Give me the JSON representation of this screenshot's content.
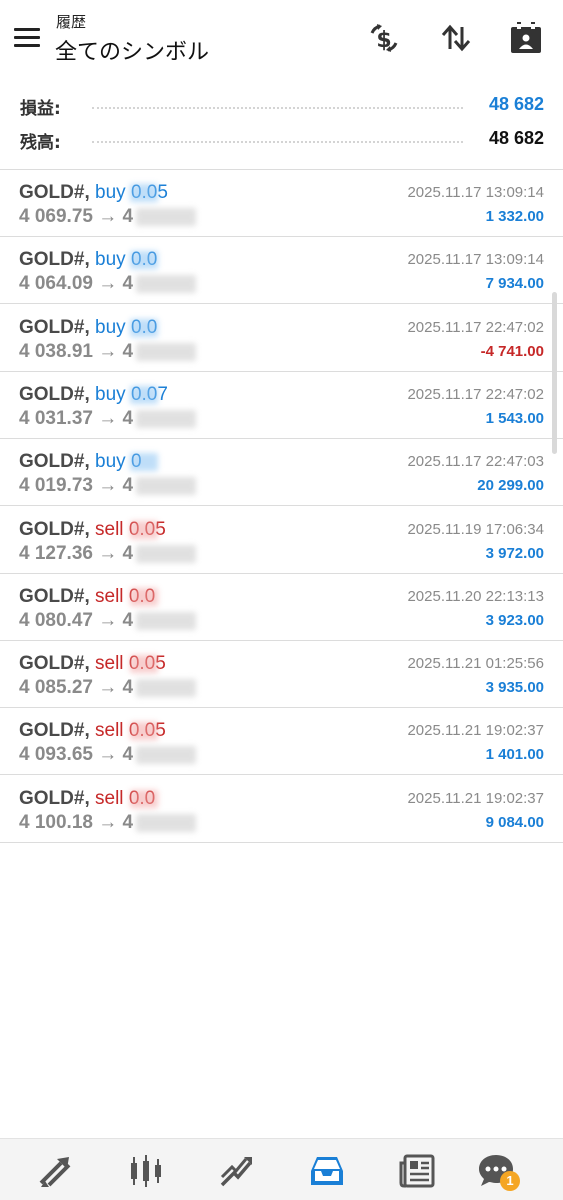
{
  "header": {
    "subtitle": "履歴",
    "title": "全てのシンボル",
    "icons": [
      "currency-exchange-icon",
      "sort-icon",
      "calendar-icon"
    ]
  },
  "summary": {
    "profit_label": "損益:",
    "profit_value": "48 682",
    "balance_label": "残高:",
    "balance_value": "48 682",
    "colors": {
      "profit": "#1a7fd6",
      "balance": "#111111"
    }
  },
  "trades": [
    {
      "symbol": "GOLD#,",
      "side": "buy",
      "volume": "0.05",
      "open_price": "4 069.75",
      "arrow": "→",
      "close_prefix": "4",
      "time": "2025.11.17 13:09:14",
      "profit": "1 332.00",
      "profit_sign": "pos"
    },
    {
      "symbol": "GOLD#,",
      "side": "buy",
      "volume": "0.0",
      "open_price": "4 064.09",
      "arrow": "→",
      "close_prefix": "4",
      "time": "2025.11.17 13:09:14",
      "profit": "7 934.00",
      "profit_sign": "pos"
    },
    {
      "symbol": "GOLD#,",
      "side": "buy",
      "volume": "0.0",
      "open_price": "4 038.91",
      "arrow": "→",
      "close_prefix": "4",
      "time": "2025.11.17 22:47:02",
      "profit": "-4 741.00",
      "profit_sign": "neg"
    },
    {
      "symbol": "GOLD#,",
      "side": "buy",
      "volume": "0.07",
      "open_price": "4 031.37",
      "arrow": "→",
      "close_prefix": "4",
      "time": "2025.11.17 22:47:02",
      "profit": "1 543.00",
      "profit_sign": "pos"
    },
    {
      "symbol": "GOLD#,",
      "side": "buy",
      "volume": "0",
      "open_price": "4 019.73",
      "arrow": "→",
      "close_prefix": "4",
      "time": "2025.11.17 22:47:03",
      "profit": "20 299.00",
      "profit_sign": "pos"
    },
    {
      "symbol": "GOLD#,",
      "side": "sell",
      "volume": "0.05",
      "open_price": "4 127.36",
      "arrow": "→",
      "close_prefix": "4",
      "time": "2025.11.19 17:06:34",
      "profit": "3 972.00",
      "profit_sign": "pos"
    },
    {
      "symbol": "GOLD#,",
      "side": "sell",
      "volume": "0.0",
      "open_price": "4 080.47",
      "arrow": "→",
      "close_prefix": "4",
      "time": "2025.11.20 22:13:13",
      "profit": "3 923.00",
      "profit_sign": "pos"
    },
    {
      "symbol": "GOLD#,",
      "side": "sell",
      "volume": "0.05",
      "open_price": "4 085.27",
      "arrow": "→",
      "close_prefix": "4",
      "time": "2025.11.21 01:25:56",
      "profit": "3 935.00",
      "profit_sign": "pos"
    },
    {
      "symbol": "GOLD#,",
      "side": "sell",
      "volume": "0.05",
      "open_price": "4 093.65",
      "arrow": "→",
      "close_prefix": "4",
      "time": "2025.11.21 19:02:37",
      "profit": "1 401.00",
      "profit_sign": "pos"
    },
    {
      "symbol": "GOLD#,",
      "side": "sell",
      "volume": "0.0",
      "open_price": "4 100.18",
      "arrow": "→",
      "close_prefix": "4",
      "time": "2025.11.21 19:02:37",
      "profit": "9 084.00",
      "profit_sign": "pos"
    }
  ],
  "colors": {
    "buy": "#1a7fd6",
    "sell": "#c62828",
    "accent": "#1a7fd6"
  },
  "bottom_nav": {
    "items": [
      "quotes-icon",
      "chart-icon",
      "trade-icon",
      "history-icon",
      "news-icon",
      "messages-icon"
    ],
    "active": "history-icon",
    "messages_badge": "1"
  }
}
